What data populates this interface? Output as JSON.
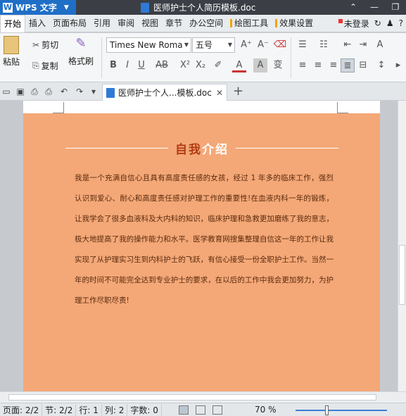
{
  "app": {
    "name": "WPS 文字",
    "logo": "W"
  },
  "window": {
    "title": "医师护士个人简历模板.doc"
  },
  "menu": {
    "tabs": [
      "开始",
      "插入",
      "页面布局",
      "引用",
      "审阅",
      "视图",
      "章节",
      "办公空间",
      "绘图工具",
      "效果设置"
    ],
    "active": "开始",
    "login": "未登录"
  },
  "ribbon": {
    "paste": "粘贴",
    "cut": "剪切",
    "copy": "复制",
    "format_painter": "格式刷",
    "font_name": "Times New Roma",
    "font_size": "五号"
  },
  "doc_tab": {
    "label": "医师护士个人...模板.doc"
  },
  "document": {
    "heading_part1": "自我",
    "heading_part2": "介绍",
    "paragraph": "我是一个充满自信心且具有高度责任感的女孩，经过 1 年多的临床工作，强烈认识到爱心、耐心和高度责任感对护理工作的重要性!在血液内科一年的锻炼，让我学会了很多血液科及大内科的知识，临床护理和急救更加磨练了我的意志，极大地提高了我的操作能力和水平。医学教育网搜集整理自信这一年的工作让我实现了从护理实习生到内科护士的飞跃，有信心接受一份全职护士工作。当然一年的时间不可能完全达到专业护士的要求，在以后的工作中我会更加努力，为护理工作尽职尽责!"
  },
  "status": {
    "page": "页面: 2/2",
    "section": "节: 2/2",
    "row": "行: 1",
    "col": "列: 2",
    "chars": "字数: 0",
    "zoom": "70 %",
    "zoom_level": 0.7
  },
  "colors": {
    "page_bg": "#f4a877",
    "heading_accent": "#b03c12",
    "app_blue": "#1f6fc6"
  }
}
